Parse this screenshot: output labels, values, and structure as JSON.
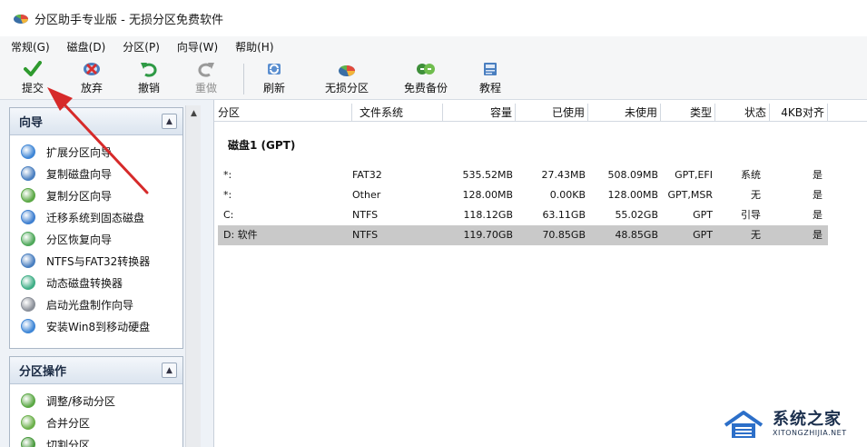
{
  "window": {
    "title": "分区助手专业版 - 无损分区免费软件"
  },
  "menu": {
    "items": [
      "常规(G)",
      "磁盘(D)",
      "分区(P)",
      "向导(W)",
      "帮助(H)"
    ]
  },
  "toolbar": {
    "commit": "提交",
    "discard": "放弃",
    "undo": "撤销",
    "redo": "重做",
    "refresh": "刷新",
    "lossless_partition": "无损分区",
    "free_backup": "免费备份",
    "tutorial": "教程"
  },
  "wizard_section": {
    "title": "向导",
    "items": [
      {
        "label": "扩展分区向导",
        "icon": "extend-partition-icon"
      },
      {
        "label": "复制磁盘向导",
        "icon": "copy-disk-icon"
      },
      {
        "label": "复制分区向导",
        "icon": "copy-partition-icon"
      },
      {
        "label": "迁移系统到固态磁盘",
        "icon": "migrate-ssd-icon"
      },
      {
        "label": "分区恢复向导",
        "icon": "partition-recovery-icon"
      },
      {
        "label": "NTFS与FAT32转换器",
        "icon": "ntfs-fat32-convert-icon"
      },
      {
        "label": "动态磁盘转换器",
        "icon": "dynamic-disk-convert-icon"
      },
      {
        "label": "启动光盘制作向导",
        "icon": "bootable-media-icon"
      },
      {
        "label": "安装Win8到移动硬盘",
        "icon": "win8-to-go-icon"
      }
    ]
  },
  "partition_ops_section": {
    "title": "分区操作",
    "items": [
      {
        "label": "调整/移动分区",
        "icon": "resize-move-icon"
      },
      {
        "label": "合并分区",
        "icon": "merge-partition-icon"
      },
      {
        "label": "切割分区",
        "icon": "split-partition-icon"
      }
    ]
  },
  "table": {
    "columns": [
      "分区",
      "文件系统",
      "容量",
      "已使用",
      "未使用",
      "类型",
      "状态",
      "4KB对齐"
    ],
    "disk_title": "磁盘1 (GPT)",
    "rows": [
      {
        "partition": "*:",
        "fs": "FAT32",
        "capacity": "535.52MB",
        "used": "27.43MB",
        "unused": "508.09MB",
        "type": "GPT,EFI",
        "status": "系统",
        "aligned": "是"
      },
      {
        "partition": "*:",
        "fs": "Other",
        "capacity": "128.00MB",
        "used": "0.00KB",
        "unused": "128.00MB",
        "type": "GPT,MSR",
        "status": "无",
        "aligned": "是"
      },
      {
        "partition": "C:",
        "fs": "NTFS",
        "capacity": "118.12GB",
        "used": "63.11GB",
        "unused": "55.02GB",
        "type": "GPT",
        "status": "引导",
        "aligned": "是"
      },
      {
        "partition": "D: 软件",
        "fs": "NTFS",
        "capacity": "119.70GB",
        "used": "70.85GB",
        "unused": "48.85GB",
        "type": "GPT",
        "status": "无",
        "aligned": "是"
      }
    ]
  },
  "watermark": {
    "name": "系统之家",
    "url": "XITONGZHIJIA.NET"
  },
  "colors": {
    "selected_row": "#c9c9c9",
    "annotation_arrow": "#d62a2a",
    "panel_bg": "#eef2f7"
  }
}
